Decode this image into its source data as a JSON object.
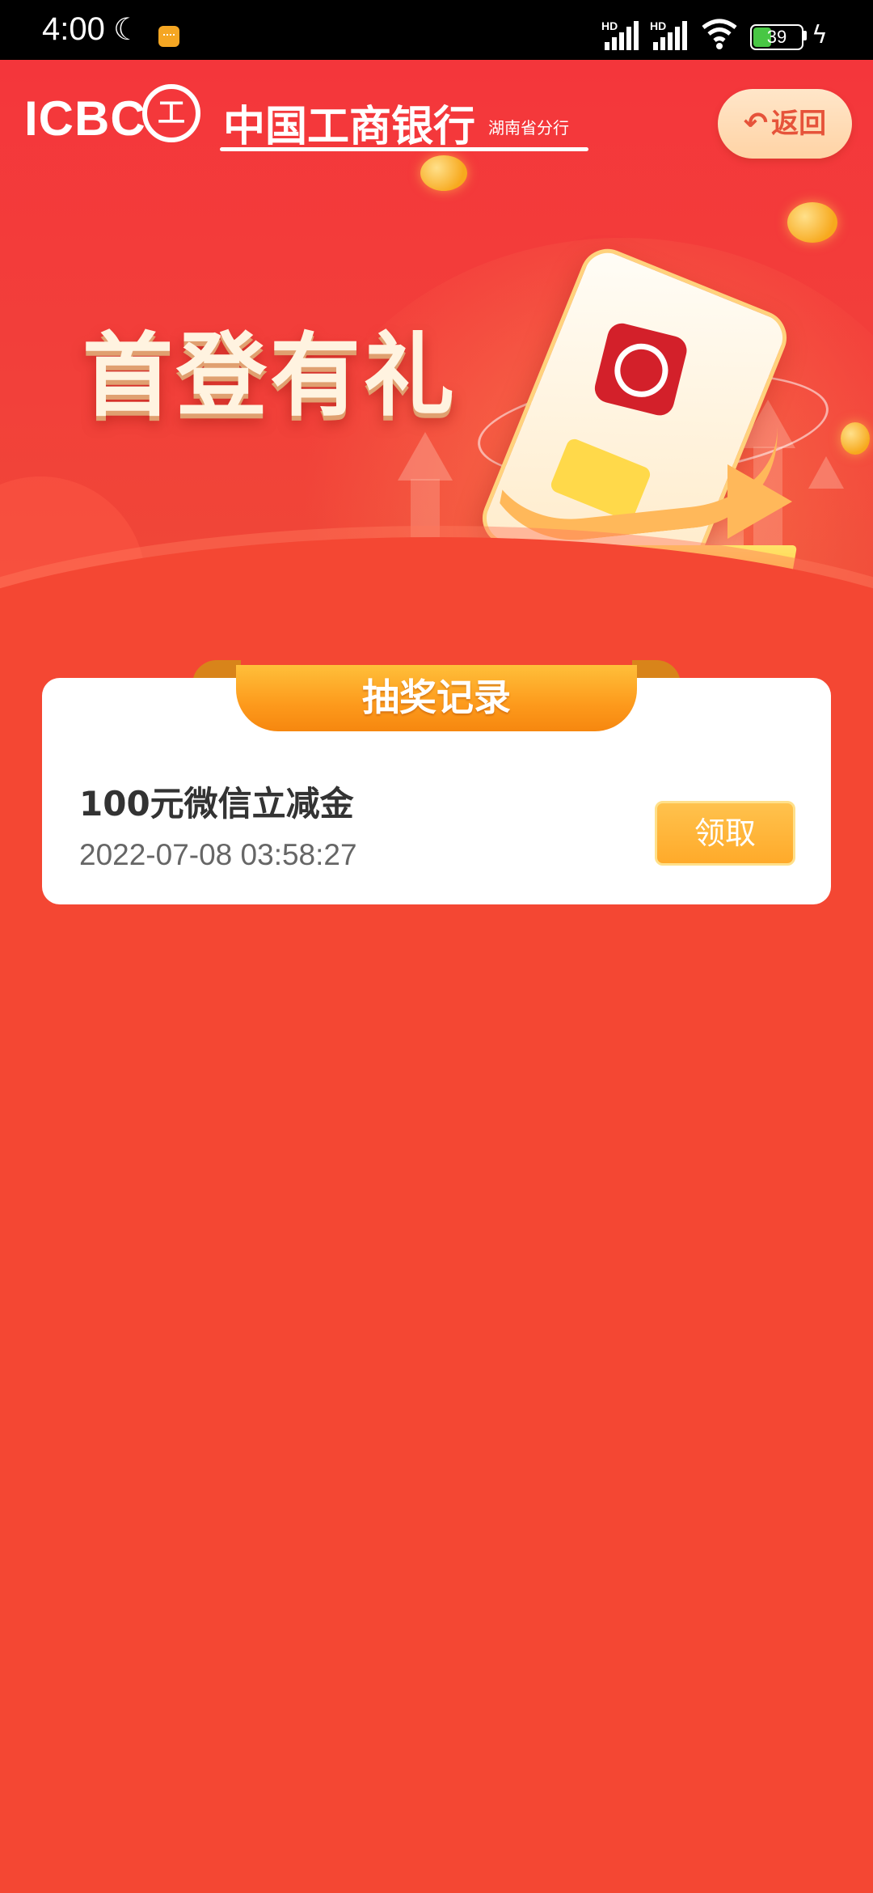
{
  "status_bar": {
    "time": "4:00",
    "battery": "39",
    "network_labels": [
      "HD",
      "HD"
    ]
  },
  "header": {
    "logo_text": "ICBC",
    "bank_name": "中国工商银行",
    "branch": "湖南省分行",
    "back_label": "返回"
  },
  "banner": {
    "title": "首登有礼"
  },
  "records": {
    "section_title": "抽奖记录",
    "items": [
      {
        "prize": "100元微信立减金",
        "time": "2022-07-08  03:58:27",
        "action_label": "领取"
      }
    ]
  },
  "colors": {
    "page_background": "#f44733",
    "accent_orange": "#fd9a1c",
    "button_gold": "#ffb436",
    "card_background": "#ffffff"
  }
}
